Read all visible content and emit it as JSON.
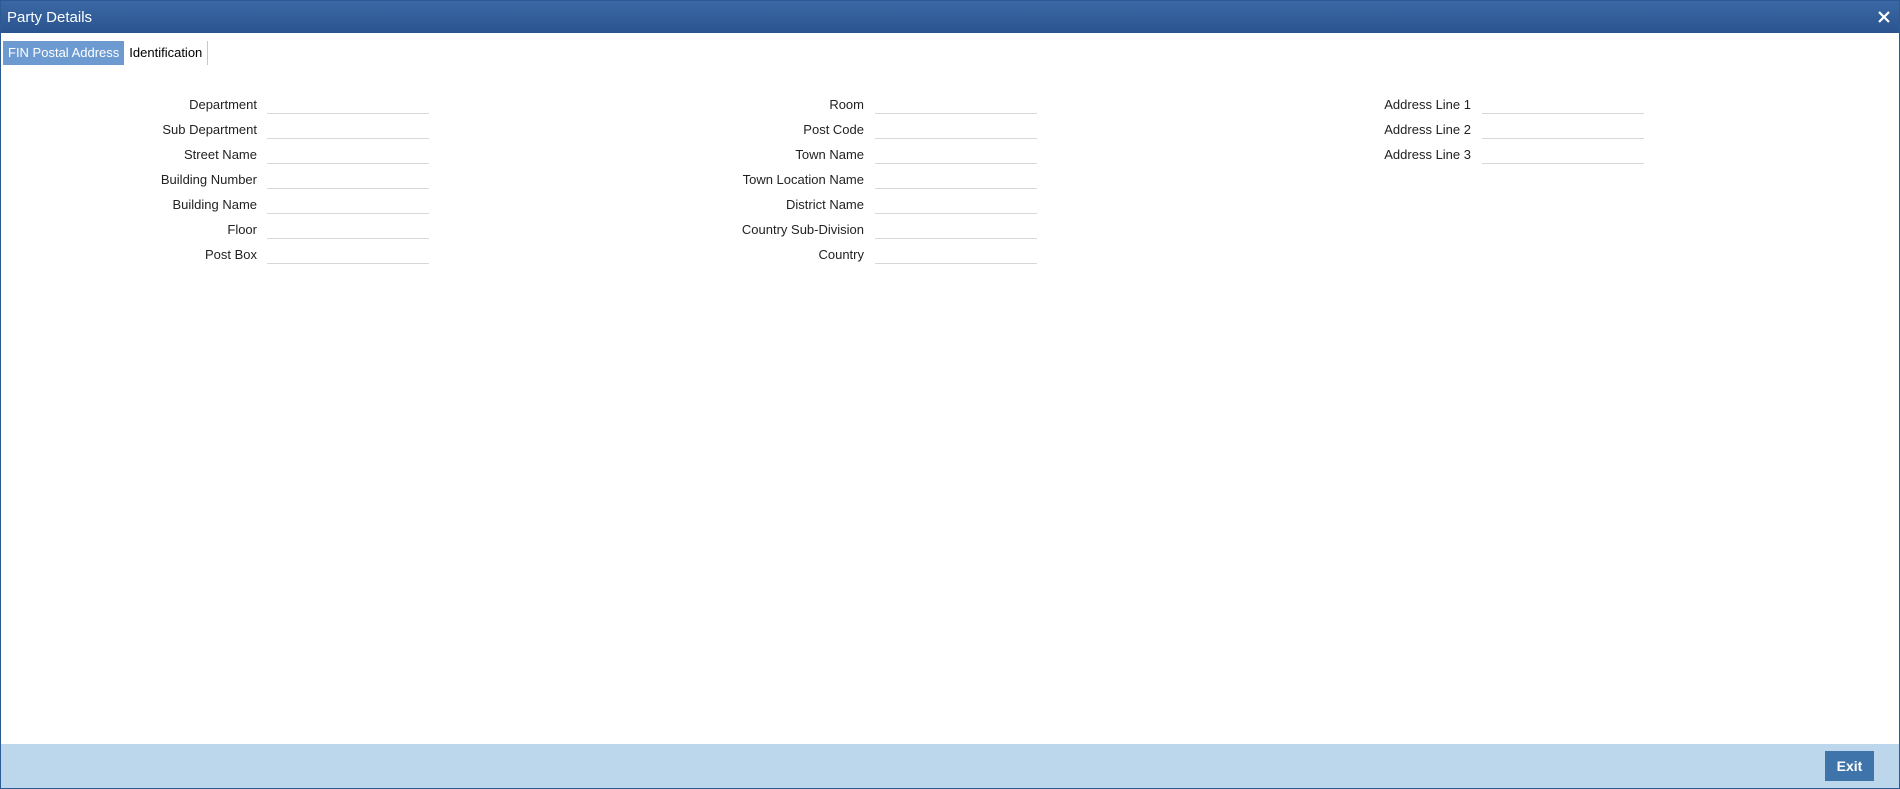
{
  "window": {
    "title": "Party Details",
    "close_glyph": "✕"
  },
  "tabs": [
    {
      "label": "FIN Postal Address",
      "active": true
    },
    {
      "label": "Identification",
      "active": false
    }
  ],
  "form": {
    "column1": [
      {
        "label": "Department",
        "value": ""
      },
      {
        "label": "Sub Department",
        "value": ""
      },
      {
        "label": "Street Name",
        "value": ""
      },
      {
        "label": "Building Number",
        "value": ""
      },
      {
        "label": "Building Name",
        "value": ""
      },
      {
        "label": "Floor",
        "value": ""
      },
      {
        "label": "Post Box",
        "value": ""
      }
    ],
    "column2": [
      {
        "label": "Room",
        "value": ""
      },
      {
        "label": "Post Code",
        "value": ""
      },
      {
        "label": "Town Name",
        "value": ""
      },
      {
        "label": "Town Location Name",
        "value": ""
      },
      {
        "label": "District Name",
        "value": ""
      },
      {
        "label": "Country Sub-Division",
        "value": ""
      },
      {
        "label": "Country",
        "value": ""
      }
    ],
    "column3": [
      {
        "label": "Address Line 1",
        "value": ""
      },
      {
        "label": "Address Line 2",
        "value": ""
      },
      {
        "label": "Address Line 3",
        "value": ""
      }
    ]
  },
  "footer": {
    "exit_label": "Exit"
  },
  "colors": {
    "title_bar": "#2f5b94",
    "active_tab": "#6c9ad1",
    "footer": "#bcd7ec",
    "exit_button": "#3e74aa"
  }
}
